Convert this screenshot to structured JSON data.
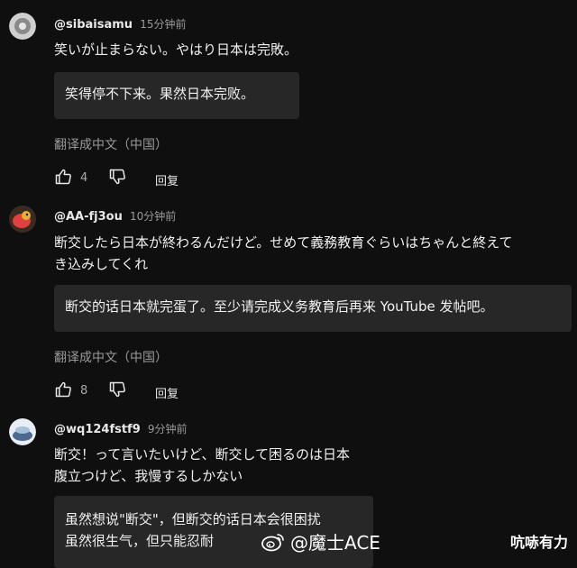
{
  "comments": [
    {
      "handle": "@sibaisamu",
      "time": "15分钟前",
      "lines": [
        "笑いが止まらない。やはり日本は完敗。"
      ],
      "translation": [
        "笑得停不下来。果然日本完败。"
      ],
      "translate_link": "翻译成中文（中国）",
      "likes": "4",
      "reply_label": "回复",
      "avatar_icon": "profile-avatar-icon",
      "avatar_color": "#d9d9d9"
    },
    {
      "handle": "@AA-fj3ou",
      "time": "10分钟前",
      "lines": [
        "断交したら日本が終わるんだけど。せめて義務教育ぐらいはちゃんと終えて",
        "き込みしてくれ"
      ],
      "translation": [
        "断交的话日本就完蛋了。至少请完成义务教育后再来 YouTube 发帖吧。"
      ],
      "translate_link": "翻译成中文（中国）",
      "likes": "8",
      "reply_label": "回复",
      "avatar_icon": "profile-avatar-icon",
      "avatar_color": "#e04040"
    },
    {
      "handle": "@wq124fstf9",
      "time": "9分钟前",
      "lines": [
        "断交！って言いたいけど、断交して困るのは日本",
        "腹立つけど、我慢するしかない"
      ],
      "translation": [
        "虽然想说\"断交\"，但断交的话日本会很困扰",
        "虽然很生气，但只能忍耐"
      ],
      "avatar_icon": "profile-avatar-icon",
      "avatar_color": "#7fa0c0"
    }
  ],
  "watermark": {
    "icon": "weibo-icon",
    "text": "@魔士ACE"
  },
  "brand": "吭哧有力"
}
